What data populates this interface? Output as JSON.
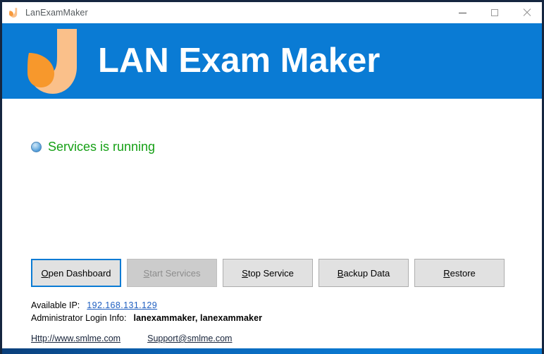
{
  "window": {
    "titlebar": {
      "icon": "leaf-logo-icon",
      "title": "LanExamMaker",
      "minimize_label": "Minimize",
      "maximize_label": "Maximize",
      "close_label": "Close"
    },
    "banner": {
      "logo_icon": "lan-exam-maker-logo-icon",
      "title": "LAN Exam Maker",
      "background_color": "#0a7bd4"
    }
  },
  "status": {
    "indicator_icon": "status-circle-icon",
    "indicator_color": "#4a97d6",
    "text": "Services is running",
    "text_color": "#16a016"
  },
  "buttons": [
    {
      "name": "open-dashboard",
      "label": "Open Dashboard",
      "accesskey": "O",
      "accesskey_index": 0,
      "state": "focused",
      "disabled": false
    },
    {
      "name": "start-services",
      "label": "Start Services",
      "accesskey": "S",
      "accesskey_index": 0,
      "state": "disabled",
      "disabled": true
    },
    {
      "name": "stop-service",
      "label": "Stop Service",
      "accesskey": "S",
      "accesskey_index": 0,
      "state": "normal",
      "disabled": false
    },
    {
      "name": "backup-data",
      "label": "Backup Data",
      "accesskey": "B",
      "accesskey_index": 0,
      "state": "normal",
      "disabled": false
    },
    {
      "name": "restore",
      "label": "Restore",
      "accesskey": "R",
      "accesskey_index": 0,
      "state": "normal",
      "disabled": false
    }
  ],
  "info": {
    "available_ip_label": "Available IP:",
    "available_ip_value": "192.168.131.129",
    "admin_login_label": "Administrator Login Info:",
    "admin_login_value": "lanexammaker, lanexammaker"
  },
  "footer": {
    "website": "Http://www.smlme.com",
    "support_email": "Support@smlme.com"
  }
}
